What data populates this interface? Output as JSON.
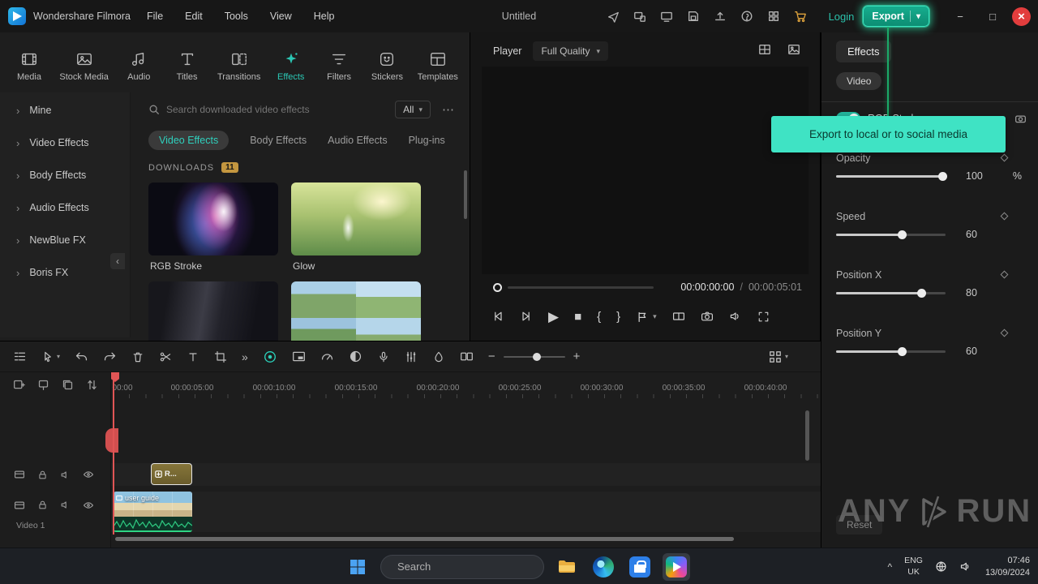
{
  "icons": {
    "chevron_down": "▾",
    "chevron_right": "›",
    "chevron_left": "‹",
    "more": "⋯",
    "double_chevron": "»",
    "brace_open": "{",
    "brace_close": "}",
    "play": "▶",
    "stop": "■",
    "minimize": "−",
    "maximize": "□",
    "close": "×",
    "caret_up": "^"
  },
  "titlebar": {
    "app_name": "Wondershare Filmora",
    "menus": [
      "File",
      "Edit",
      "Tools",
      "View",
      "Help"
    ],
    "project_title": "Untitled",
    "login_label": "Login",
    "export_label": "Export"
  },
  "media_toolbar": {
    "items": [
      "Media",
      "Stock Media",
      "Audio",
      "Titles",
      "Transitions",
      "Effects",
      "Filters",
      "Stickers",
      "Templates"
    ]
  },
  "fx_sidebar": {
    "items": [
      "Mine",
      "Video Effects",
      "Body Effects",
      "Audio Effects",
      "NewBlue FX",
      "Boris FX"
    ]
  },
  "fx_panel": {
    "search_placeholder": "Search downloaded video effects",
    "filter_label": "All",
    "tabs": [
      "Video Effects",
      "Body Effects",
      "Audio Effects",
      "Plug-ins"
    ],
    "section_title": "DOWNLOADS",
    "badge_count": "11",
    "effects": [
      {
        "name": "RGB Stroke"
      },
      {
        "name": "Glow"
      }
    ]
  },
  "player": {
    "label": "Player",
    "quality": "Full Quality",
    "current_time": "00:00:00:00",
    "separator": "/",
    "duration": "00:00:05:01"
  },
  "props": {
    "tab_label": "Effects",
    "chip_label": "Video",
    "effect_name": "RGB Stroke",
    "controls": [
      {
        "label": "Opacity",
        "value": "100",
        "unit": "%",
        "percent": 97
      },
      {
        "label": "Speed",
        "value": "60",
        "unit": "",
        "percent": 60
      },
      {
        "label": "Position X",
        "value": "80",
        "unit": "",
        "percent": 78
      },
      {
        "label": "Position Y",
        "value": "60",
        "unit": "",
        "percent": 60
      }
    ],
    "reset_label": "Reset"
  },
  "tooltip": {
    "text": "Export to local or to social media"
  },
  "timeline": {
    "ruler": [
      "00:00",
      "00:00:05:00",
      "00:00:10:00",
      "00:00:15:00",
      "00:00:20:00",
      "00:00:25:00",
      "00:00:30:00",
      "00:00:35:00",
      "00:00:40:00"
    ],
    "effect_clip_label": "R...",
    "video_clip_label": "user guide",
    "track1_label": "Video 1"
  },
  "watermark": {
    "left": "ANY",
    "right": "RUN"
  },
  "taskbar": {
    "search_placeholder": "Search",
    "lang_top": "ENG",
    "lang_bottom": "UK",
    "time": "07:46",
    "date": "13/09/2024"
  }
}
